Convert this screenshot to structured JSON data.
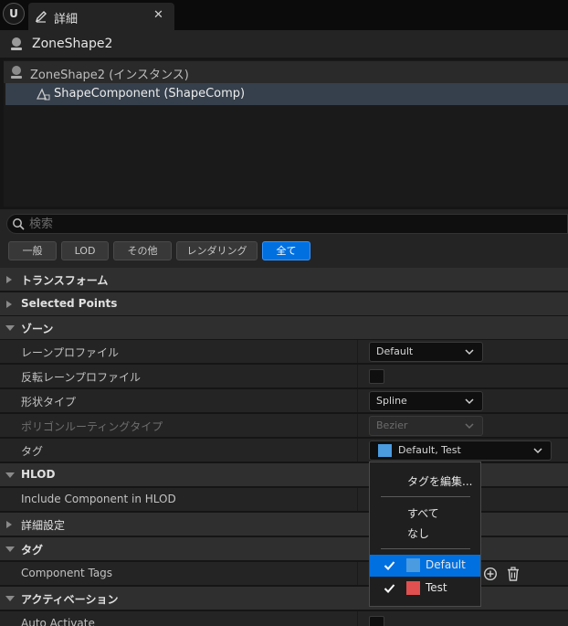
{
  "tab": {
    "title": "詳細",
    "close": "✕",
    "logo": "U"
  },
  "actor": {
    "name": "ZoneShape2"
  },
  "tree": {
    "root": "ZoneShape2 (インスタンス)",
    "child": "ShapeComponent (ShapeComp)"
  },
  "search": {
    "placeholder": "検索",
    "value": ""
  },
  "filters": [
    {
      "label": "一般"
    },
    {
      "label": "LOD"
    },
    {
      "label": "その他"
    },
    {
      "label": "レンダリング"
    },
    {
      "label": "全て",
      "active": true
    }
  ],
  "categories": {
    "transform": "トランスフォーム",
    "selected_points": "Selected Points",
    "zone": "ゾーン",
    "hlod": "HLOD",
    "advanced": "詳細設定",
    "tags": "タグ",
    "activation": "アクティベーション"
  },
  "props": {
    "lane_profile": {
      "label": "レーンプロファイル",
      "value": "Default"
    },
    "reverse_lane_profile": {
      "label": "反転レーンプロファイル",
      "checked": false
    },
    "shape_type": {
      "label": "形状タイプ",
      "value": "Spline"
    },
    "polygon_routing_type": {
      "label": "ポリゴンルーティングタイプ",
      "value": "Bezier",
      "disabled": true
    },
    "tag": {
      "label": "タグ",
      "value": "Default, Test"
    },
    "include_component_in_hlod": {
      "label": "Include Component in HLOD"
    },
    "component_tags": {
      "label": "Component Tags"
    },
    "auto_activate": {
      "label": "Auto Activate"
    }
  },
  "dropdown": {
    "edit_tags": "タグを編集...",
    "all": "すべて",
    "none": "なし",
    "items": [
      {
        "label": "Default",
        "color": "#4a9be0",
        "checked": true,
        "selected": true
      },
      {
        "label": "Test",
        "color": "#e05050",
        "checked": true,
        "selected": false
      }
    ]
  },
  "colors": {
    "accent": "#0070e0",
    "selection_row": "#36404c",
    "panel": "#242424"
  }
}
